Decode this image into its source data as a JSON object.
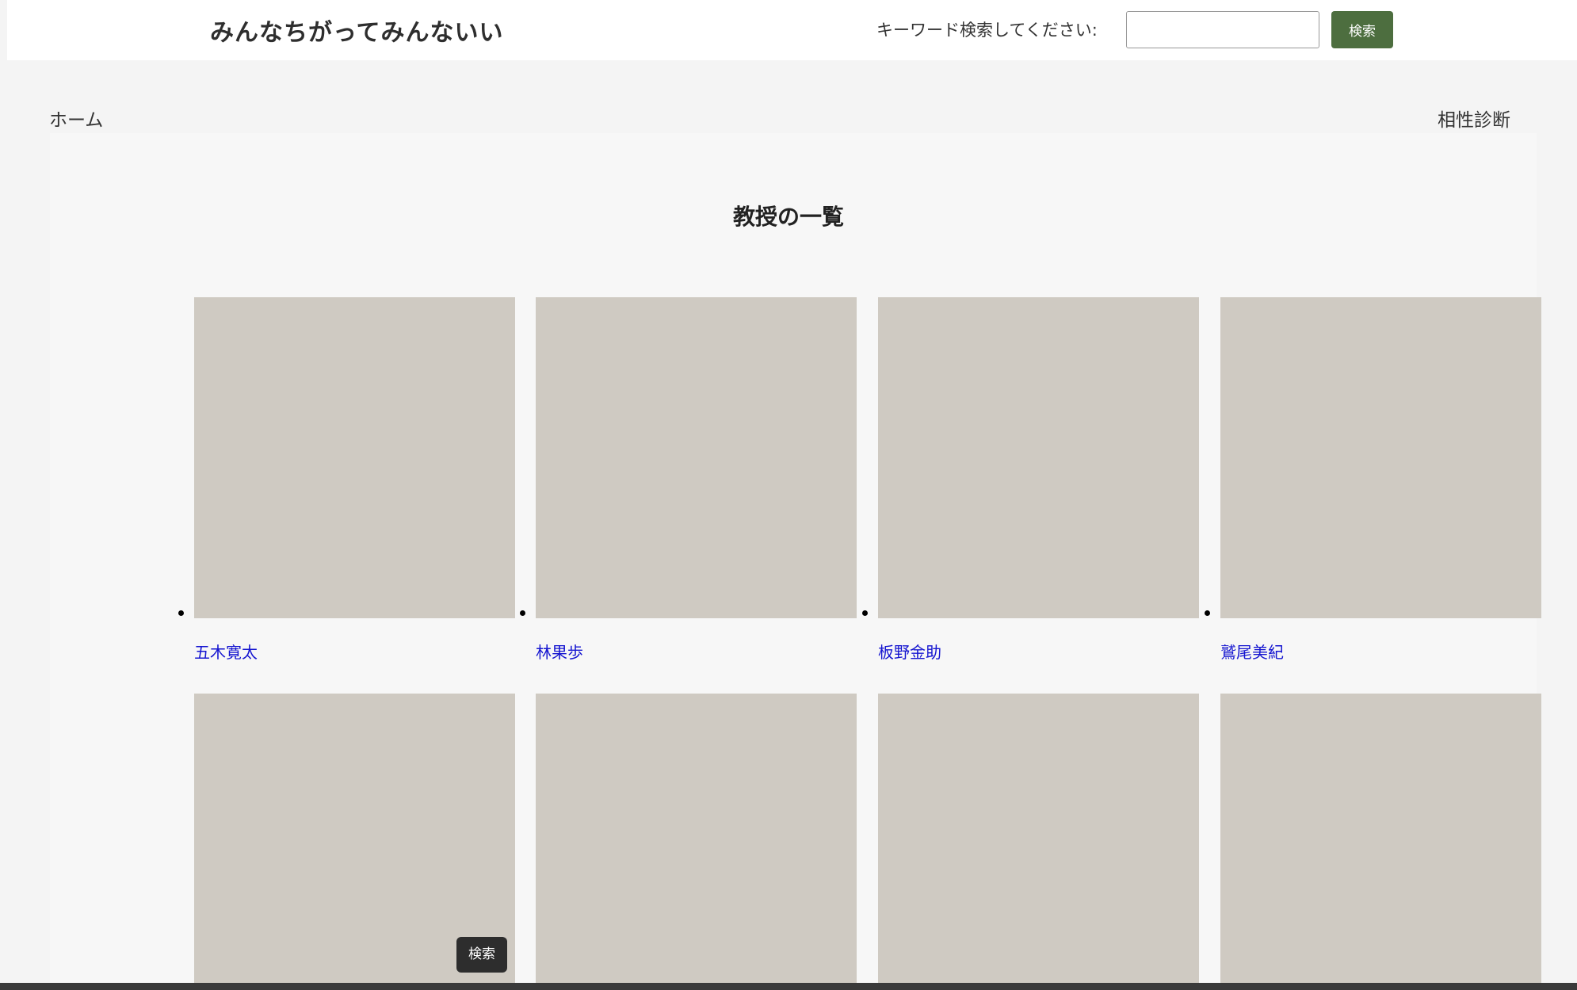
{
  "header": {
    "site_title": "みんなちがってみんないい",
    "search_label": "キーワード検索してください:",
    "search_value": "",
    "search_button": "検索"
  },
  "nav": {
    "home": "ホーム",
    "compatibility": "相性診断"
  },
  "main": {
    "heading": "教授の一覧",
    "professors": [
      {
        "name": "五木寛太"
      },
      {
        "name": "林果歩"
      },
      {
        "name": "板野金助"
      },
      {
        "name": "鷲尾美紀"
      },
      {
        "name": ""
      },
      {
        "name": ""
      },
      {
        "name": ""
      },
      {
        "name": ""
      }
    ]
  },
  "tooltip": "検索"
}
